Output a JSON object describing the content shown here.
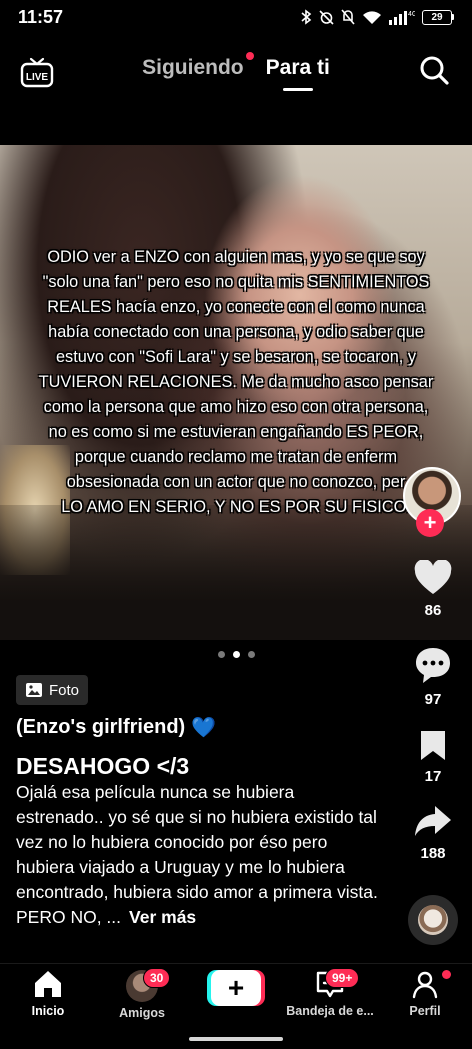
{
  "status_bar": {
    "time": "11:57",
    "battery": "29",
    "network": "4G"
  },
  "top_nav": {
    "tab_following": "Siguiendo",
    "tab_for_you": "Para ti",
    "live_label": "LIVE"
  },
  "post": {
    "overlay_lines": [
      "ODIO ver a ENZO con alguien mas, y yo se que soy",
      "\"solo una fan\" pero eso no quita mis SENTIMIENTOS",
      "REALES hacía enzo, yo conecte con el como nunca",
      "había conectado con una persona, y odio saber que",
      "estuvo con \"Sofi Lara\" y se besaron, se tocaron, y",
      "TUVIERON RELACIONES. Me da mucho asco pensar",
      "como la persona que amo hizo eso con otra persona,",
      "no es como si me estuvieran engañando ES PEOR,",
      "porque cuando reclamo me tratan de enferm",
      "obsesionada con un actor que no conozco, per",
      "LO AMO EN SERIO, Y NO ES POR SU FISICO."
    ],
    "carousel": {
      "total": 3,
      "active_index": 1
    },
    "type_badge": "Foto",
    "author": "(Enzo's girlfriend)",
    "author_emoji": "💙",
    "title": "DESAHOGO </3",
    "caption": "Ojalá esa película nunca se hubiera estrenado.. yo sé que si no hubiera existido tal vez no lo hubiera conocido por éso pero hubiera viajado a Uruguay y me lo hubiera encontrado, hubiera sido amor a primera vista. PERO NO, ...",
    "see_more": "Ver más"
  },
  "actions": {
    "likes": "86",
    "comments": "97",
    "saves": "17",
    "shares": "188"
  },
  "bottom_nav": {
    "home": "Inicio",
    "friends": "Amigos",
    "friends_badge": "30",
    "create": "+",
    "inbox": "Bandeja de e...",
    "inbox_badge": "99+",
    "profile": "Perfil"
  },
  "colors": {
    "accent": "#fe2c55",
    "cyan": "#25f4ee",
    "background": "#000000"
  }
}
